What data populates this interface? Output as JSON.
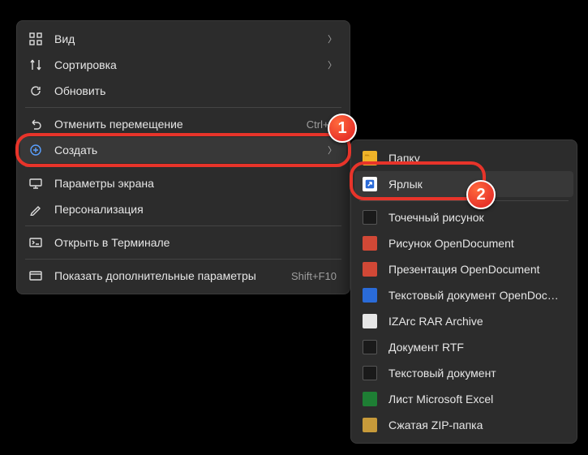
{
  "main_menu": {
    "items": [
      {
        "icon": "view",
        "label": "Вид",
        "chevron": true
      },
      {
        "icon": "sort",
        "label": "Сортировка",
        "chevron": true
      },
      {
        "icon": "refresh",
        "label": "Обновить"
      }
    ],
    "items2": [
      {
        "icon": "undo",
        "label": "Отменить перемещение",
        "shortcut": "Ctrl+Я"
      },
      {
        "icon": "new",
        "label": "Создать",
        "chevron": true,
        "highlighted": true
      }
    ],
    "items3": [
      {
        "icon": "display",
        "label": "Параметры экрана"
      },
      {
        "icon": "personalize",
        "label": "Персонализация"
      }
    ],
    "items4": [
      {
        "icon": "terminal",
        "label": "Открыть в Терминале"
      }
    ],
    "items5": [
      {
        "icon": "more",
        "label": "Показать дополнительные параметры",
        "shortcut": "Shift+F10"
      }
    ]
  },
  "sub_menu": {
    "items": [
      {
        "color": "#f0b429",
        "glyph": "",
        "label": "Папку"
      },
      {
        "color": "#2a6bd8",
        "glyph": "↗",
        "label": "Ярлык",
        "whitebg": true,
        "highlighted": true
      }
    ],
    "items2": [
      {
        "color": "#2e2e2e",
        "glyph": "",
        "label": "Точечный рисунок",
        "border": true
      },
      {
        "color": "#d14836",
        "glyph": "",
        "label": "Рисунок OpenDocument"
      },
      {
        "color": "#d14836",
        "glyph": "",
        "label": "Презентация OpenDocument"
      },
      {
        "color": "#2a6bd8",
        "glyph": "",
        "label": "Текстовый документ OpenDocument"
      },
      {
        "color": "#e6e6e6",
        "glyph": "",
        "label": "IZArc RAR Archive",
        "dark": true
      },
      {
        "color": "#2e2e2e",
        "glyph": "",
        "label": "Документ RTF",
        "border": true
      },
      {
        "color": "#2e2e2e",
        "glyph": "",
        "label": "Текстовый документ",
        "border": true
      },
      {
        "color": "#1e7e34",
        "glyph": "",
        "label": "Лист Microsoft Excel"
      },
      {
        "color": "#c79a3a",
        "glyph": "",
        "label": "Сжатая ZIP-папка"
      }
    ]
  },
  "callouts": {
    "badge1": "1",
    "badge2": "2"
  }
}
